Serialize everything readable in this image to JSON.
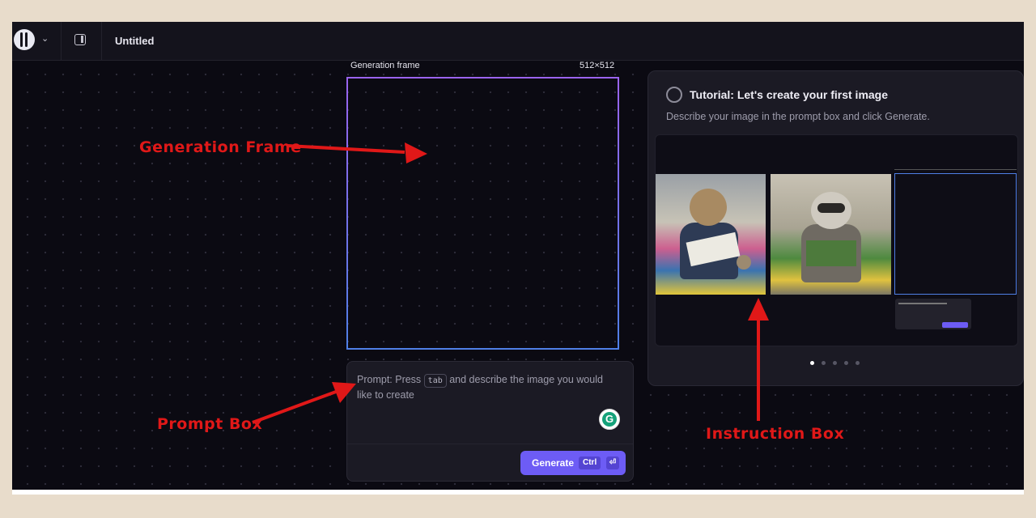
{
  "app": {
    "title": "Untitled",
    "icons": {
      "logo": "logo-icon",
      "menu": "chevron-down-icon",
      "panel": "panel-toggle-icon"
    }
  },
  "canvas": {
    "frame_label": "Generation frame",
    "frame_size": "512×512"
  },
  "prompt": {
    "text_before": "Prompt: Press",
    "key": "tab",
    "text_after": "and describe the image you would like to create",
    "assistant_letter": "G",
    "generate": {
      "label": "Generate",
      "shortcut": "Ctrl",
      "enter_symbol": "⏎"
    }
  },
  "tutorial": {
    "title": "Tutorial: Let's create your first image",
    "description": "Describe your image in the prompt box and click Generate.",
    "slide_count": 5,
    "active_slide": 1
  },
  "annotations": {
    "frame": "Generation Frame",
    "prompt": "Prompt Box",
    "instruction": "Instruction Box"
  },
  "colors": {
    "annotation": "#e01818",
    "accent": "#6d5cf5",
    "frame_gradient_top": "#9a63ee",
    "frame_gradient_bottom": "#4f7fe6"
  }
}
